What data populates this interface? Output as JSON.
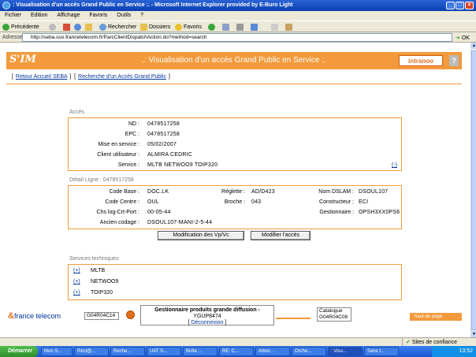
{
  "window": {
    "title": ": Visualisation d'un accès Grand Public en Service :. - Microsoft Internet Explorer provided by E-Buro Light"
  },
  "menu": [
    "Fichier",
    "Edition",
    "Affichage",
    "Favoris",
    "Outils",
    "?"
  ],
  "toolbar": {
    "back_label": "Précédente",
    "search_label": "Rechercher",
    "folders_label": "Dossiers",
    "favorites_label": "Favoris"
  },
  "address": {
    "label": "Adresse",
    "url": "http://seba.sso.francetelecom.fr/ParcClientDispatchAction.do?method=search",
    "go_label": "OK"
  },
  "page": {
    "logo": "S'IM",
    "title": ".: Visualisation d'un accès Grand Public en Service :.",
    "intranoo": "intranoo",
    "help": "?",
    "link_home": "Retour Accueil SEBA",
    "link_search": "Recherche d'un Accès Grand Public"
  },
  "acces": {
    "section": "Accès",
    "fields": [
      {
        "label": "ND :",
        "value": "0478517258"
      },
      {
        "label": "EPC :",
        "value": "0478517258"
      },
      {
        "label": "Mise en service :",
        "value": "05/02/2007"
      },
      {
        "label": "Client utilisateur :",
        "value": "ALMIRA CEDRIC"
      },
      {
        "label": "Service :",
        "value": "MLTB NETWOO9 TOIP320"
      }
    ],
    "expand": "(-)"
  },
  "ligne": {
    "section": "Détail Ligne : 0478517258",
    "col1": [
      {
        "label": "Code Base :",
        "value": "DOC.LK"
      },
      {
        "label": "Code Centre :",
        "value": "OUL"
      },
      {
        "label": "Chs log-Crt-Port :",
        "value": "00-05-44"
      },
      {
        "label": "Ancien codage :",
        "value": "DSOUL107-MANI-2-5-44"
      }
    ],
    "col2": [
      {
        "label": "Réglette :",
        "value": "AD/D423"
      },
      {
        "label": "Broche :",
        "value": "043"
      }
    ],
    "col3": [
      {
        "label": "Nom DSLAM :",
        "value": "DSOUL107"
      },
      {
        "label": "Constructeur :",
        "value": "ECI"
      },
      {
        "label": "Gestionnaire :",
        "value": "OPSH3XX0PS6"
      }
    ],
    "btn_vpvc": "Modification des Vp/Vc",
    "btn_modify": "Modifier l'accès"
  },
  "services": {
    "section": "Services techniques",
    "items": [
      {
        "link": "(+)",
        "name": "MLTB"
      },
      {
        "link": "(+)",
        "name": "NETWOO9"
      },
      {
        "link": "(+)",
        "name": "TOIP320"
      }
    ]
  },
  "footer": {
    "brand": "france telecom",
    "code_left": "G04R04C14",
    "center_title": "Gestionnaire produits grande diffusion -",
    "center_user": "YGUP8474",
    "logout": "Déconnexion",
    "catalogue_label": "Catalogue",
    "catalogue_code": "G04R04C08",
    "top_link": "haut de page"
  },
  "status": {
    "zone": "Sites de confiance"
  },
  "taskbar": {
    "start": "Démarrer",
    "items": [
      "Mon S...",
      "Récl@...",
      "Reche...",
      "UAT S...",
      "Boîte ...",
      "RE: C...",
      "Arbor...",
      "Orche...",
      ": Visu...",
      "Sans t..."
    ],
    "clock": "13:52"
  },
  "colors": {
    "accent": "#f39a3c",
    "link": "#003399"
  }
}
